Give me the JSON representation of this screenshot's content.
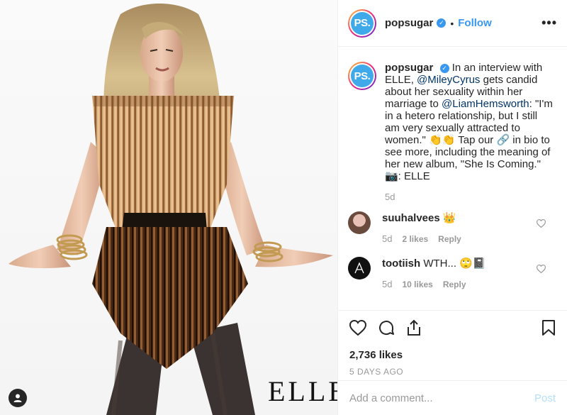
{
  "photo": {
    "brand_mark": "ELLE",
    "tag_icon": "user-tag-icon"
  },
  "header": {
    "avatar_text": "PS.",
    "username": "popsugar",
    "verified_icon": "verified-badge-icon",
    "separator": "•",
    "follow_label": "Follow",
    "more_icon": "more-options-icon"
  },
  "caption": {
    "avatar_text": "PS.",
    "username": "popsugar",
    "text_1": "In an interview with ELLE, ",
    "mention_1": "@MileyCyrus",
    "text_2": " gets candid about her sexuality within her marriage to ",
    "mention_2": "@LiamHemsworth",
    "text_3": ": \"I'm in a hetero relationship, but I still am very sexually attracted to women.\" 👏👏 Tap our 🔗 in bio to see more, including the meaning of her new album, \"She Is Coming.\"",
    "credit": "📷: ELLE",
    "time": "5d"
  },
  "comments": [
    {
      "username": "suuhalvees",
      "text": "👑",
      "time": "5d",
      "likes": "2 likes",
      "reply": "Reply"
    },
    {
      "username": "tootiish",
      "text": "WTH... 🙄📓",
      "time": "5d",
      "likes": "10 likes",
      "reply": "Reply"
    }
  ],
  "actions": {
    "like_icon": "heart-icon",
    "comment_icon": "comment-icon",
    "share_icon": "share-icon",
    "save_icon": "bookmark-icon",
    "likes": "2,736 likes",
    "date": "5 DAYS AGO"
  },
  "add_comment": {
    "placeholder": "Add a comment...",
    "post_label": "Post"
  }
}
